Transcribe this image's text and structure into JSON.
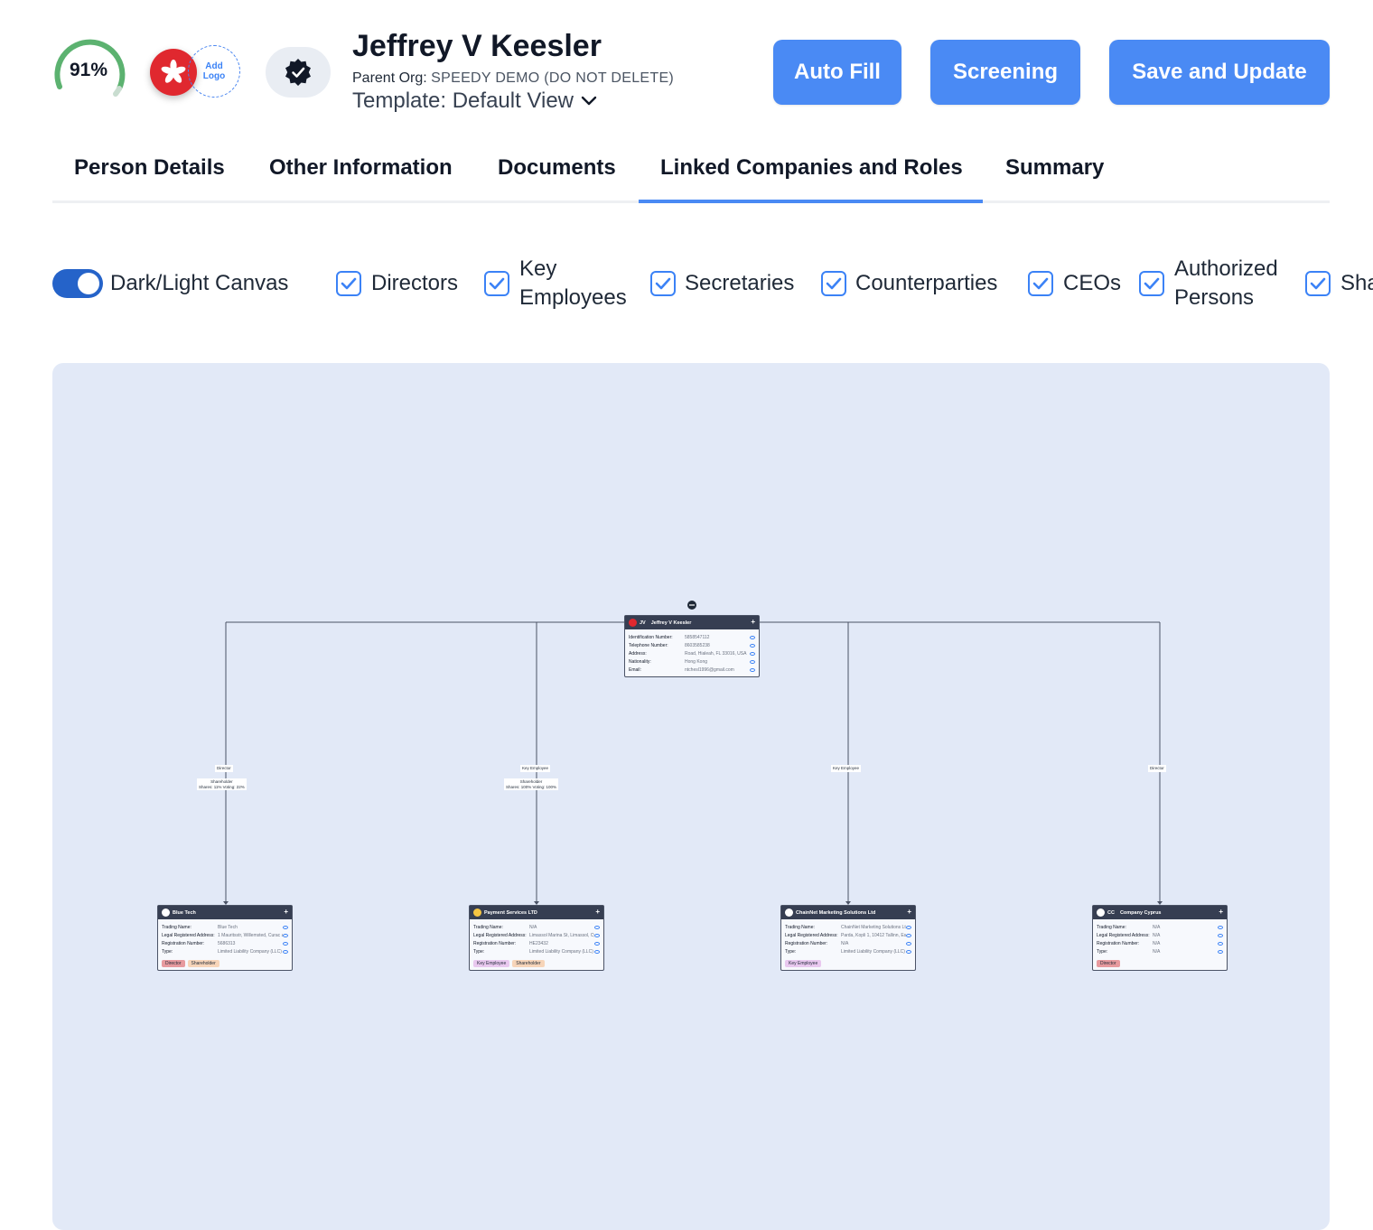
{
  "header": {
    "completion": "91%",
    "completion_fraction": 0.91,
    "add_logo": [
      "Add",
      "Logo"
    ],
    "person_name": "Jeffrey V Keesler",
    "parent_org_label": "Parent Org:",
    "parent_org_value": "SPEEDY DEMO (DO NOT DELETE)",
    "template_label": "Template: Default View",
    "icons": {
      "flag": "hong-kong-flag-icon",
      "verified": "verified-badge-icon",
      "dropdown": "chevron-down-icon"
    }
  },
  "actions": {
    "auto_fill": "Auto Fill",
    "screening": "Screening",
    "save_update": "Save and Update"
  },
  "tabs": [
    {
      "label": "Person Details",
      "active": false
    },
    {
      "label": "Other Information",
      "active": false
    },
    {
      "label": "Documents",
      "active": false
    },
    {
      "label": "Linked Companies and Roles",
      "active": true
    },
    {
      "label": "Summary",
      "active": false
    }
  ],
  "filters": {
    "canvas_toggle": "Dark/Light Canvas",
    "directors": "Directors",
    "key_employees": [
      "Key",
      "Employees"
    ],
    "secretaries": "Secretaries",
    "counterparties": "Counterparties",
    "ceos": "CEOs",
    "authorized_persons": [
      "Authorized",
      "Persons"
    ],
    "shareholders_partial": "Sha"
  },
  "graph": {
    "root": {
      "initials": "JV",
      "name": "Jeffrey V Keesler",
      "rows": [
        {
          "k": "Identification Number:",
          "v": "5858547112"
        },
        {
          "k": "Telephone Number:",
          "v": "8603585238"
        },
        {
          "k": "Address:",
          "v": "Road, Hialeah, FL 33016, USA"
        },
        {
          "k": "Nationality:",
          "v": "Hong Kong"
        },
        {
          "k": "Email:",
          "v": "ntchesl1996@gmail.com"
        }
      ]
    },
    "edges": [
      {
        "role": "Director",
        "extra": [
          "Shareholder",
          "Shares: 11%   Voting: 22%"
        ]
      },
      {
        "role": "Key Employee",
        "extra": [
          "Shareholder",
          "Shares: 100%   Voting: 100%"
        ]
      },
      {
        "role": "Key Employee",
        "extra": []
      },
      {
        "role": "Director",
        "extra": []
      }
    ],
    "companies": [
      {
        "name": "Blue Tech",
        "rows": [
          {
            "k": "Trading Name:",
            "v": "Blue Tech"
          },
          {
            "k": "Legal Registered Address:",
            "v": "1 Mauritsstr, Willemsted, Curac ao"
          },
          {
            "k": "Registration Number:",
            "v": "5686313"
          },
          {
            "k": "Type:",
            "v": "Limited Liability Company (LLC)"
          }
        ],
        "badges": [
          "Director",
          "Shareholder"
        ]
      },
      {
        "name": "Payment Services LTD",
        "rows": [
          {
            "k": "Trading Name:",
            "v": "N/A"
          },
          {
            "k": "Legal Registered Address:",
            "v": "Limassol Marina St, Limassol, Cyp rus"
          },
          {
            "k": "Registration Number:",
            "v": "HE23432"
          },
          {
            "k": "Type:",
            "v": "Limited Liability Company (LLC)"
          }
        ],
        "badges": [
          "Key Employee",
          "Shareholder"
        ]
      },
      {
        "name": "ChainNet Marketing Solutions Ltd",
        "rows": [
          {
            "k": "Trading Name:",
            "v": "ChainNet Marketing Solutions Lt d"
          },
          {
            "k": "Legal Registered Address:",
            "v": "Parda, Kopli 1, 10412 Tallinn, Est onia"
          },
          {
            "k": "Registration Number:",
            "v": "N/A"
          },
          {
            "k": "Type:",
            "v": "Limited Liability Company (LLC)"
          }
        ],
        "badges": [
          "Key Employee"
        ]
      },
      {
        "name": "Company Cyprus",
        "initials": "CC",
        "rows": [
          {
            "k": "Trading Name:",
            "v": "N/A"
          },
          {
            "k": "Legal Registered Address:",
            "v": "N/A"
          },
          {
            "k": "Registration Number:",
            "v": "N/A"
          },
          {
            "k": "Type:",
            "v": "N/A"
          }
        ],
        "badges": [
          "Director"
        ]
      }
    ]
  },
  "colors": {
    "accent": "#4a8af4",
    "toggle": "#2563c9",
    "canvas": "#e2e9f7",
    "node_header": "#363e52",
    "gauge": "#4caf6a",
    "flag": "#e0282f"
  }
}
